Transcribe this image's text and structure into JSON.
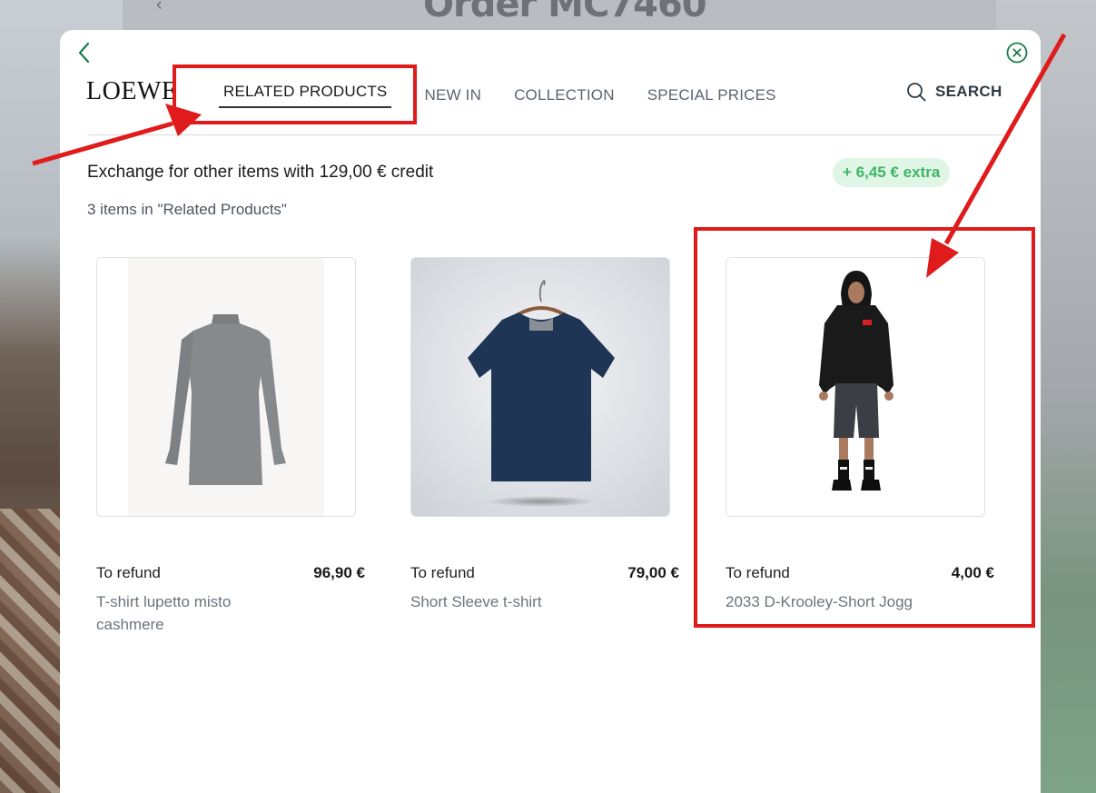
{
  "background": {
    "title": "Order MC7460"
  },
  "header": {
    "logo": "LOEWE",
    "nav": [
      {
        "label": "RELATED PRODUCTS",
        "active": true
      },
      {
        "label": "NEW IN",
        "active": false
      },
      {
        "label": "COLLECTION",
        "active": false
      },
      {
        "label": "SPECIAL PRICES",
        "active": false
      }
    ],
    "search_label": "SEARCH"
  },
  "exchange": {
    "heading": "Exchange for other items with 129,00 € credit",
    "extra_badge": "+ 6,45 € extra",
    "count_text": "3 items in \"Related Products\""
  },
  "products": [
    {
      "refund_label": "To refund",
      "price": "96,90 €",
      "name": "T-shirt lupetto misto cashmere",
      "image": "grey-turtleneck-sweater"
    },
    {
      "refund_label": "To refund",
      "price": "79,00 €",
      "name": "Short Sleeve t-shirt",
      "image": "navy-tshirt-on-hanger"
    },
    {
      "refund_label": "To refund",
      "price": "4,00 €",
      "name": "2033 D-Krooley-Short Jogg",
      "image": "model-black-hoodie-denim-shorts"
    }
  ],
  "colors": {
    "accent_green": "#1a7a4f",
    "badge_bg": "#dff5e5",
    "badge_text": "#3fb566",
    "annotation_red": "#e01b1b"
  }
}
